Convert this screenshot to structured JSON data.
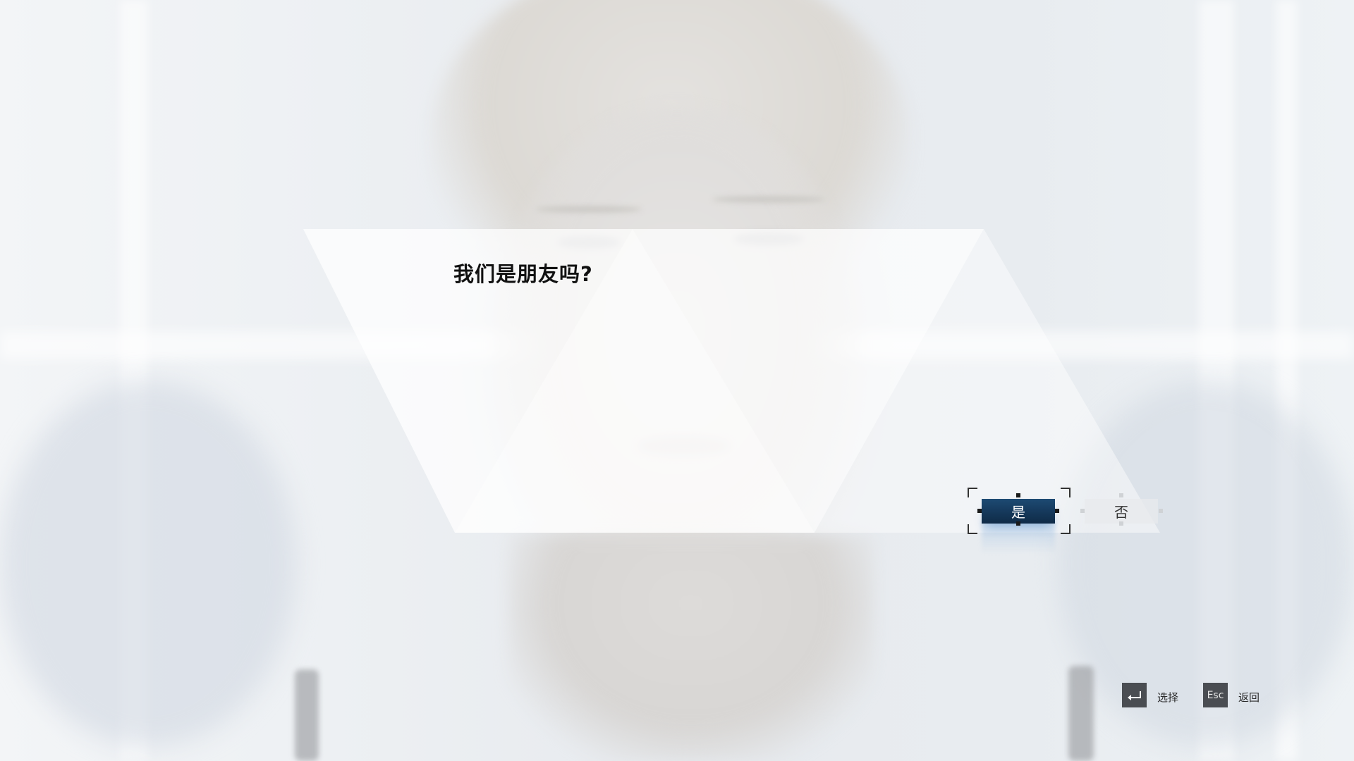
{
  "dialog": {
    "question": "我们是朋友吗?"
  },
  "choices": [
    {
      "label": "是",
      "selected": true
    },
    {
      "label": "否",
      "selected": false
    }
  ],
  "hints": [
    {
      "key": "enter",
      "key_label": "",
      "label": "选择"
    },
    {
      "key": "esc",
      "key_label": "Esc",
      "label": "返回"
    }
  ],
  "colors": {
    "selected_button": "#15385a",
    "dialog_panel": "#ffffff",
    "hint_key": "#4a4d52"
  },
  "icons": {
    "enter": "enter-key-icon"
  }
}
